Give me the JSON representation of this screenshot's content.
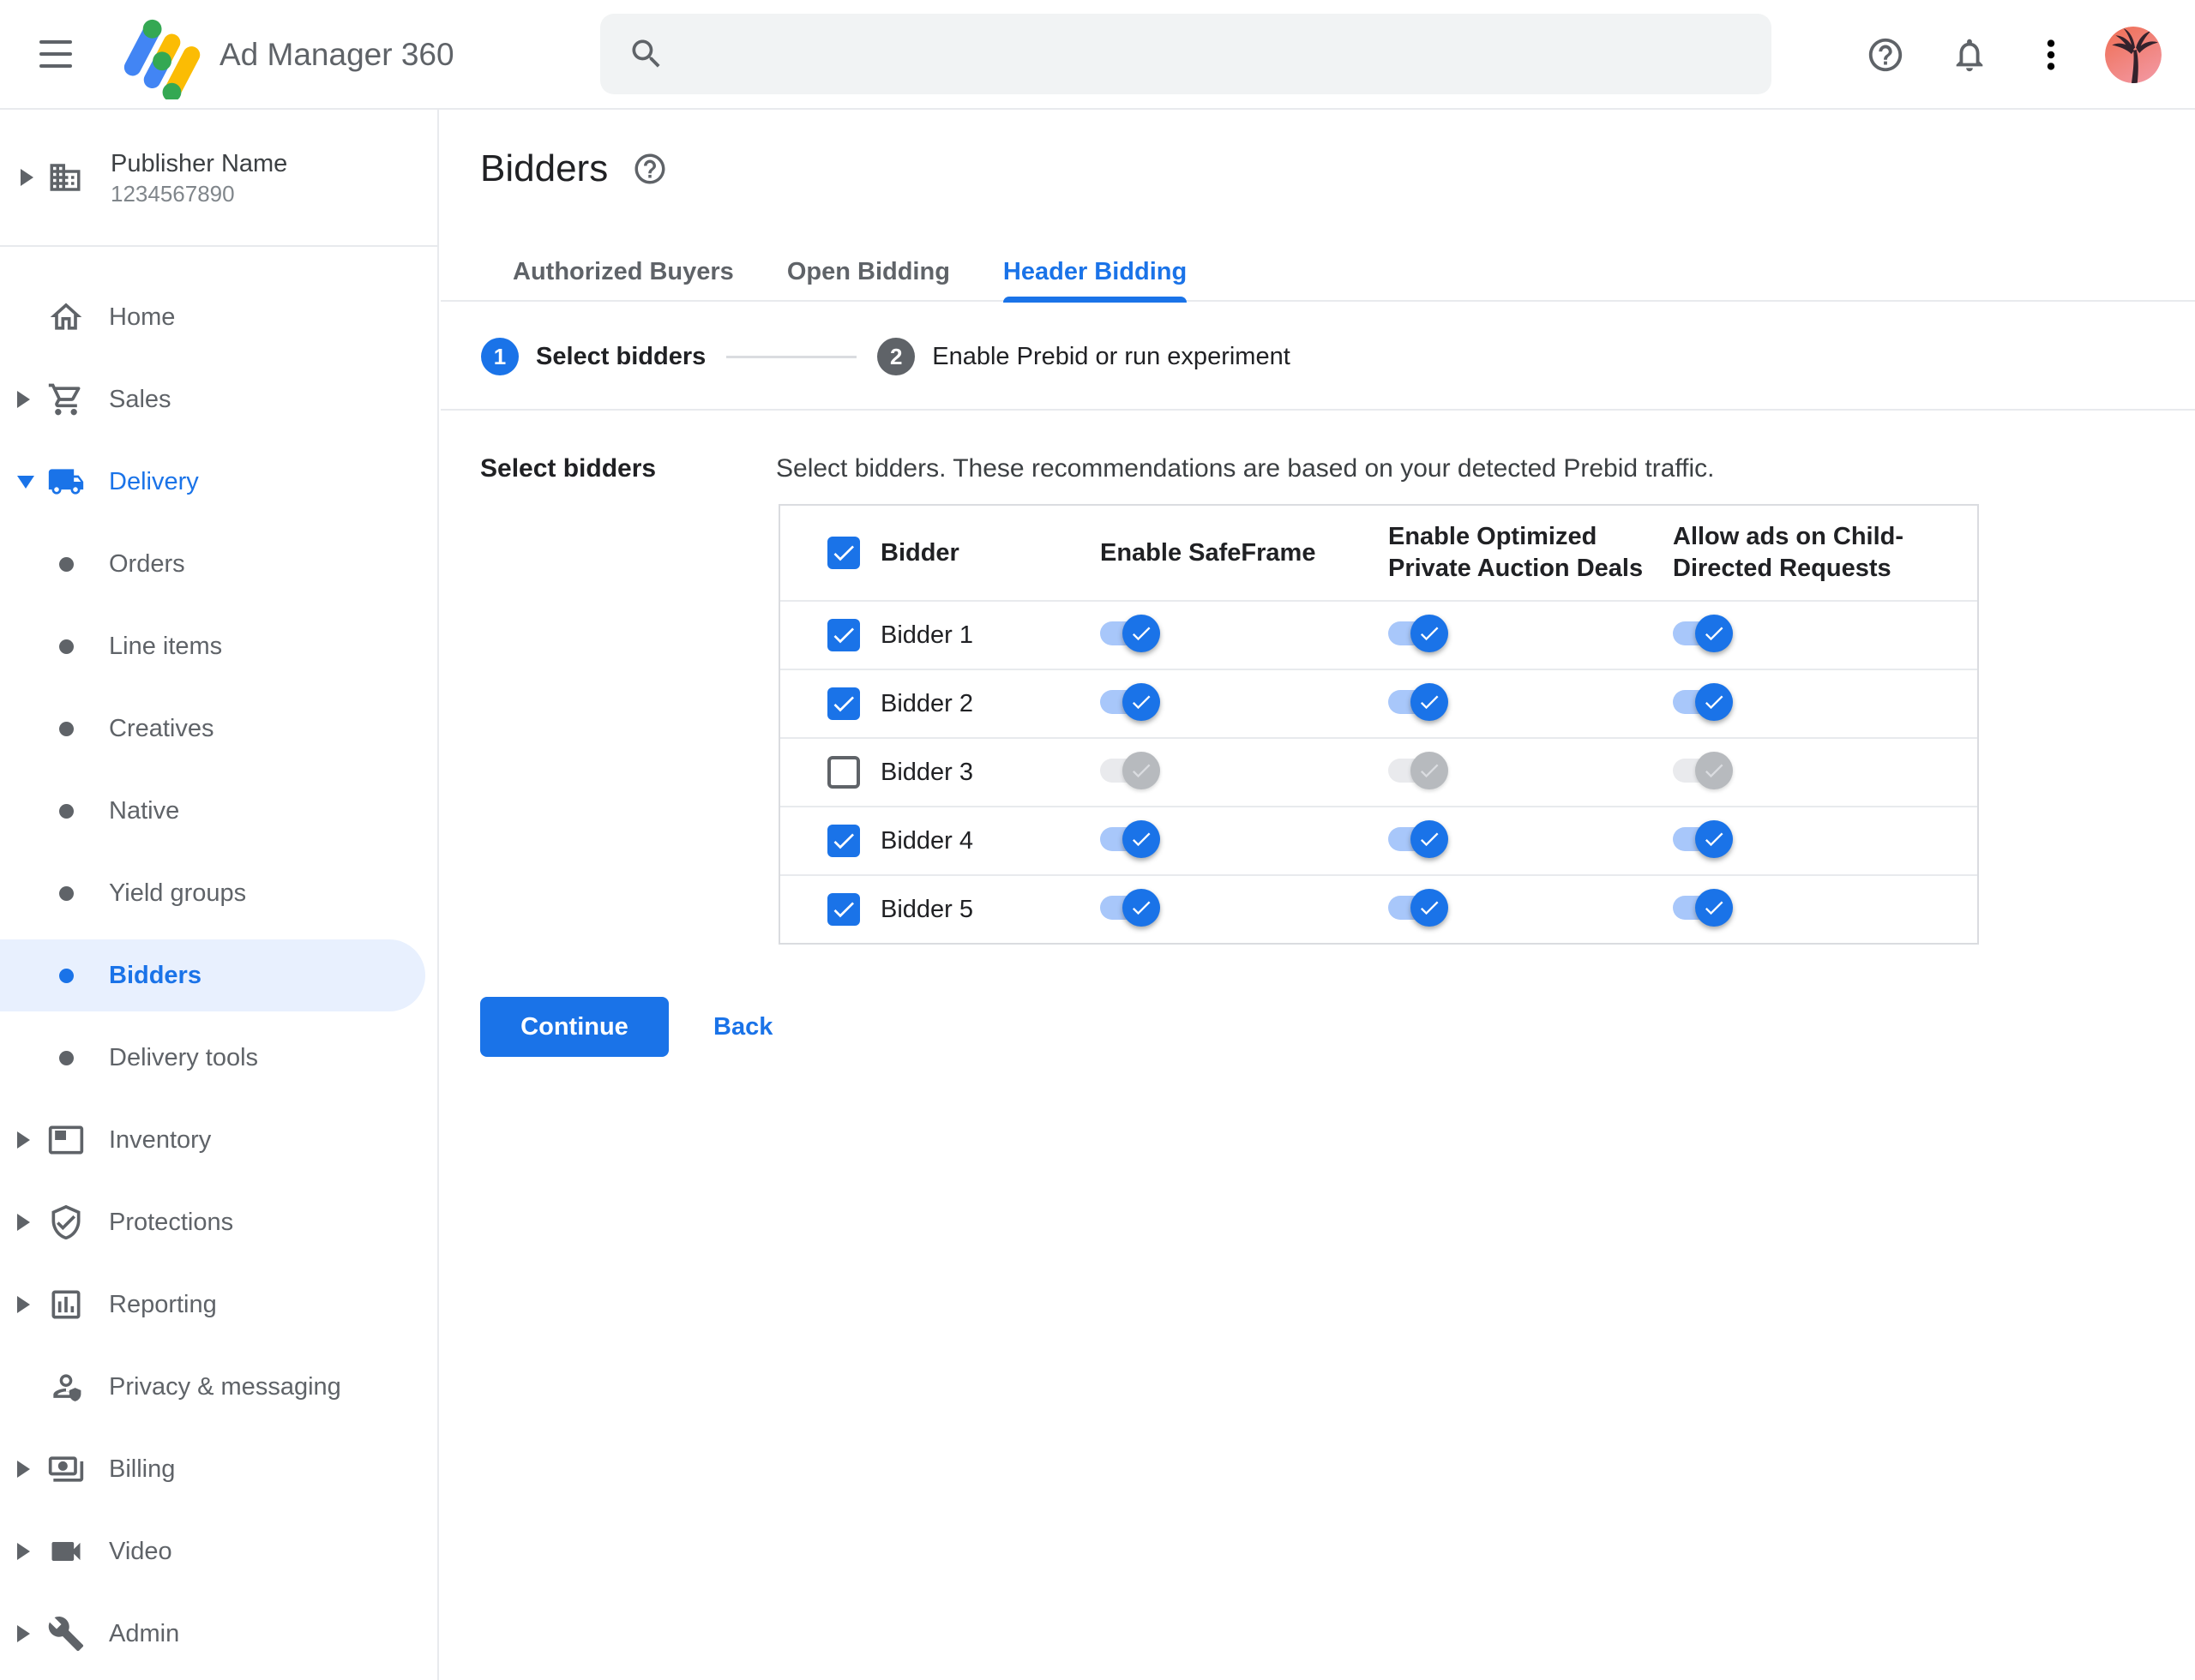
{
  "topbar": {
    "product_name": "Ad Manager 360",
    "search_placeholder": ""
  },
  "sidebar": {
    "publisher_name": "Publisher Name",
    "publisher_id": "1234567890",
    "items": [
      {
        "label": "Home",
        "icon": "home-icon",
        "level": 0
      },
      {
        "label": "Sales",
        "icon": "cart-icon",
        "level": 0,
        "has_caret": true
      },
      {
        "label": "Delivery",
        "icon": "truck-icon",
        "level": 0,
        "has_caret": true,
        "expanded": true
      },
      {
        "label": "Orders",
        "level": 1
      },
      {
        "label": "Line items",
        "level": 1
      },
      {
        "label": "Creatives",
        "level": 1
      },
      {
        "label": "Native",
        "level": 1
      },
      {
        "label": "Yield groups",
        "level": 1
      },
      {
        "label": "Bidders",
        "level": 1,
        "selected": true
      },
      {
        "label": "Delivery tools",
        "level": 1
      },
      {
        "label": "Inventory",
        "icon": "inventory-icon",
        "level": 0,
        "has_caret": true
      },
      {
        "label": "Protections",
        "icon": "shield-check-icon",
        "level": 0,
        "has_caret": true
      },
      {
        "label": "Reporting",
        "icon": "bar-chart-icon",
        "level": 0,
        "has_caret": true
      },
      {
        "label": "Privacy & messaging",
        "icon": "person-badge-icon",
        "level": 0
      },
      {
        "label": "Billing",
        "icon": "payments-icon",
        "level": 0,
        "has_caret": true
      },
      {
        "label": "Video",
        "icon": "video-camera-icon",
        "level": 0,
        "has_caret": true
      },
      {
        "label": "Admin",
        "icon": "wrench-icon",
        "level": 0,
        "has_caret": true
      }
    ]
  },
  "page": {
    "title": "Bidders"
  },
  "tabs": {
    "authorized_buyers": "Authorized Buyers",
    "open_bidding": "Open Bidding",
    "header_bidding": "Header Bidding",
    "active": "Header Bidding"
  },
  "stepper": {
    "step1_number": "1",
    "step1_label": "Select bidders",
    "step2_number": "2",
    "step2_label": "Enable Prebid or run experiment"
  },
  "form": {
    "section_label": "Select bidders",
    "description": "Select bidders. These recommendations are based on your detected Prebid traffic."
  },
  "table": {
    "header_checked": true,
    "col_bidder": "Bidder",
    "col_safeframe": "Enable SafeFrame",
    "col_auction": "Enable Optimized Private Auction Deals",
    "col_child": "Allow ads on Child-Directed Requests",
    "rows": [
      {
        "name": "Bidder 1",
        "checked": true,
        "safeframe": true,
        "auction": true,
        "child": true
      },
      {
        "name": "Bidder 2",
        "checked": true,
        "safeframe": true,
        "auction": true,
        "child": true
      },
      {
        "name": "Bidder 3",
        "checked": false,
        "safeframe": false,
        "auction": false,
        "child": false
      },
      {
        "name": "Bidder 4",
        "checked": true,
        "safeframe": true,
        "auction": true,
        "child": true
      },
      {
        "name": "Bidder 5",
        "checked": true,
        "safeframe": true,
        "auction": true,
        "child": true
      }
    ]
  },
  "actions": {
    "continue_label": "Continue",
    "back_label": "Back"
  },
  "colors": {
    "accent_blue": "#1a73e8",
    "selected_item_bg": "#e8f0fe",
    "toggle_track_on": "#a8c7fa",
    "toggle_disabled_thumb": "#b7babe",
    "search_bg": "#f1f3f4",
    "logo_blue": "#4285f4",
    "logo_yellow": "#fbbc04",
    "logo_green": "#34a853"
  }
}
